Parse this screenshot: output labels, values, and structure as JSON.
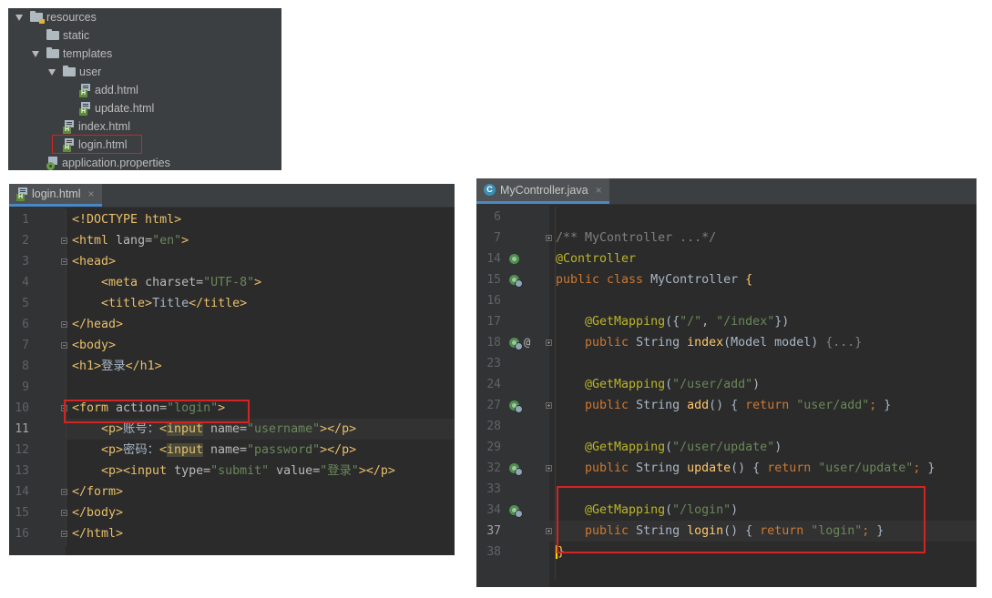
{
  "tree": {
    "items": [
      {
        "label": "resources",
        "depth": 0,
        "type": "resource-folder",
        "expanded": true
      },
      {
        "label": "static",
        "depth": 1,
        "type": "folder"
      },
      {
        "label": "templates",
        "depth": 1,
        "type": "folder",
        "expanded": true
      },
      {
        "label": "user",
        "depth": 2,
        "type": "folder",
        "expanded": true
      },
      {
        "label": "add.html",
        "depth": 3,
        "type": "html"
      },
      {
        "label": "update.html",
        "depth": 3,
        "type": "html"
      },
      {
        "label": "index.html",
        "depth": 2,
        "type": "html"
      },
      {
        "label": "login.html",
        "depth": 2,
        "type": "html",
        "highlighted": true
      },
      {
        "label": "application.properties",
        "depth": 1,
        "type": "properties"
      }
    ]
  },
  "html_editor": {
    "tab_label": "login.html",
    "close_glyph": "×",
    "line_numbers": [
      "1",
      "2",
      "3",
      "4",
      "5",
      "6",
      "7",
      "8",
      "9",
      "10",
      "11",
      "12",
      "13",
      "14",
      "15",
      "16"
    ],
    "lines": [
      [
        {
          "t": "<!DOCTYPE html>",
          "c": "tag"
        }
      ],
      [
        {
          "t": "<html ",
          "c": "tag"
        },
        {
          "t": "lang=",
          "c": "attr"
        },
        {
          "t": "\"en\"",
          "c": "str"
        },
        {
          "t": ">",
          "c": "tag"
        }
      ],
      [
        {
          "t": "<head>",
          "c": "tag"
        }
      ],
      [
        {
          "t": "    <meta ",
          "c": "tag"
        },
        {
          "t": "charset=",
          "c": "attr"
        },
        {
          "t": "\"UTF-8\"",
          "c": "str"
        },
        {
          "t": ">",
          "c": "tag"
        }
      ],
      [
        {
          "t": "    <title>",
          "c": "tag"
        },
        {
          "t": "Title",
          "c": "txt"
        },
        {
          "t": "</title>",
          "c": "tag"
        }
      ],
      [
        {
          "t": "</head>",
          "c": "tag"
        }
      ],
      [
        {
          "t": "<body>",
          "c": "tag"
        }
      ],
      [
        {
          "t": "<h1>",
          "c": "tag"
        },
        {
          "t": "登录",
          "c": "txt"
        },
        {
          "t": "</h1>",
          "c": "tag"
        }
      ],
      [],
      [
        {
          "t": "<form ",
          "c": "tag"
        },
        {
          "t": "action=",
          "c": "attr"
        },
        {
          "t": "\"login\"",
          "c": "str"
        },
        {
          "t": ">",
          "c": "tag"
        }
      ],
      [
        {
          "t": "    <p>",
          "c": "tag"
        },
        {
          "t": "账号：",
          "c": "txt"
        },
        {
          "t": "<",
          "c": "tag"
        },
        {
          "t": "input",
          "c": "tag warn"
        },
        {
          "t": " name=",
          "c": "attr"
        },
        {
          "t": "\"username\"",
          "c": "str"
        },
        {
          "t": "></p>",
          "c": "tag"
        }
      ],
      [
        {
          "t": "    <p>",
          "c": "tag"
        },
        {
          "t": "密码：",
          "c": "txt"
        },
        {
          "t": "<",
          "c": "tag"
        },
        {
          "t": "input",
          "c": "tag warn"
        },
        {
          "t": " name=",
          "c": "attr"
        },
        {
          "t": "\"password\"",
          "c": "str"
        },
        {
          "t": "></p>",
          "c": "tag"
        }
      ],
      [
        {
          "t": "    <p><input ",
          "c": "tag"
        },
        {
          "t": "type=",
          "c": "attr"
        },
        {
          "t": "\"submit\"",
          "c": "str"
        },
        {
          "t": " value=",
          "c": "attr"
        },
        {
          "t": "\"登录\"",
          "c": "str"
        },
        {
          "t": "></p>",
          "c": "tag"
        }
      ],
      [
        {
          "t": "</form>",
          "c": "tag"
        }
      ],
      [
        {
          "t": "</body>",
          "c": "tag"
        }
      ],
      [
        {
          "t": "</html>",
          "c": "tag"
        }
      ]
    ]
  },
  "java_editor": {
    "tab_label": "MyController.java",
    "close_glyph": "×",
    "class_icon_letter": "C",
    "line_numbers": [
      "6",
      "7",
      "14",
      "15",
      "16",
      "17",
      "18",
      "23",
      "24",
      "27",
      "28",
      "29",
      "32",
      "33",
      "34",
      "37",
      "38"
    ],
    "lines": [
      [],
      [
        {
          "t": "/** MyController ...*/",
          "c": "cmt"
        }
      ],
      [
        {
          "t": "@Controller",
          "c": "ann"
        }
      ],
      [
        {
          "t": "public class ",
          "c": "kw"
        },
        {
          "t": "MyController ",
          "c": "txt"
        },
        {
          "t": "{",
          "c": "fn"
        }
      ],
      [],
      [
        {
          "t": "    @GetMapping",
          "c": "ann"
        },
        {
          "t": "({",
          "c": "txt"
        },
        {
          "t": "\"/\"",
          "c": "str"
        },
        {
          "t": ", ",
          "c": "txt"
        },
        {
          "t": "\"/index\"",
          "c": "str"
        },
        {
          "t": "})",
          "c": "txt"
        }
      ],
      [
        {
          "t": "    public ",
          "c": "kw"
        },
        {
          "t": "String ",
          "c": "txt"
        },
        {
          "t": "index",
          "c": "fn"
        },
        {
          "t": "(Model model) ",
          "c": "txt"
        },
        {
          "t": "{...}",
          "c": "cmt"
        }
      ],
      [],
      [
        {
          "t": "    @GetMapping",
          "c": "ann"
        },
        {
          "t": "(",
          "c": "txt"
        },
        {
          "t": "\"/user/add\"",
          "c": "str"
        },
        {
          "t": ")",
          "c": "txt"
        }
      ],
      [
        {
          "t": "    public ",
          "c": "kw"
        },
        {
          "t": "String ",
          "c": "txt"
        },
        {
          "t": "add",
          "c": "fn"
        },
        {
          "t": "() { ",
          "c": "txt"
        },
        {
          "t": "return ",
          "c": "kw"
        },
        {
          "t": "\"user/add\"",
          "c": "str"
        },
        {
          "t": "; ",
          "c": "kw"
        },
        {
          "t": "}",
          "c": "txt"
        }
      ],
      [],
      [
        {
          "t": "    @GetMapping",
          "c": "ann"
        },
        {
          "t": "(",
          "c": "txt"
        },
        {
          "t": "\"/user/update\"",
          "c": "str"
        },
        {
          "t": ")",
          "c": "txt"
        }
      ],
      [
        {
          "t": "    public ",
          "c": "kw"
        },
        {
          "t": "String ",
          "c": "txt"
        },
        {
          "t": "update",
          "c": "fn"
        },
        {
          "t": "() { ",
          "c": "txt"
        },
        {
          "t": "return ",
          "c": "kw"
        },
        {
          "t": "\"user/update\"",
          "c": "str"
        },
        {
          "t": "; ",
          "c": "kw"
        },
        {
          "t": "}",
          "c": "txt"
        }
      ],
      [],
      [
        {
          "t": "    @GetMapping",
          "c": "ann"
        },
        {
          "t": "(",
          "c": "txt"
        },
        {
          "t": "\"/login\"",
          "c": "str"
        },
        {
          "t": ")",
          "c": "txt"
        }
      ],
      [
        {
          "t": "    public ",
          "c": "kw"
        },
        {
          "t": "String ",
          "c": "txt"
        },
        {
          "t": "login",
          "c": "fn"
        },
        {
          "t": "() { ",
          "c": "txt"
        },
        {
          "t": "return ",
          "c": "kw"
        },
        {
          "t": "\"login\"",
          "c": "str"
        },
        {
          "t": "; ",
          "c": "kw"
        },
        {
          "t": "}",
          "c": "txt"
        }
      ],
      [
        {
          "t": "}",
          "c": "fn caret"
        }
      ],
      []
    ]
  },
  "colors": {
    "editor_bg": "#2b2b2b",
    "highlight_box": "#d32323",
    "tag": "#e8bf6a",
    "string": "#6a8759",
    "keyword": "#cc7832",
    "annotation": "#bbb529"
  }
}
